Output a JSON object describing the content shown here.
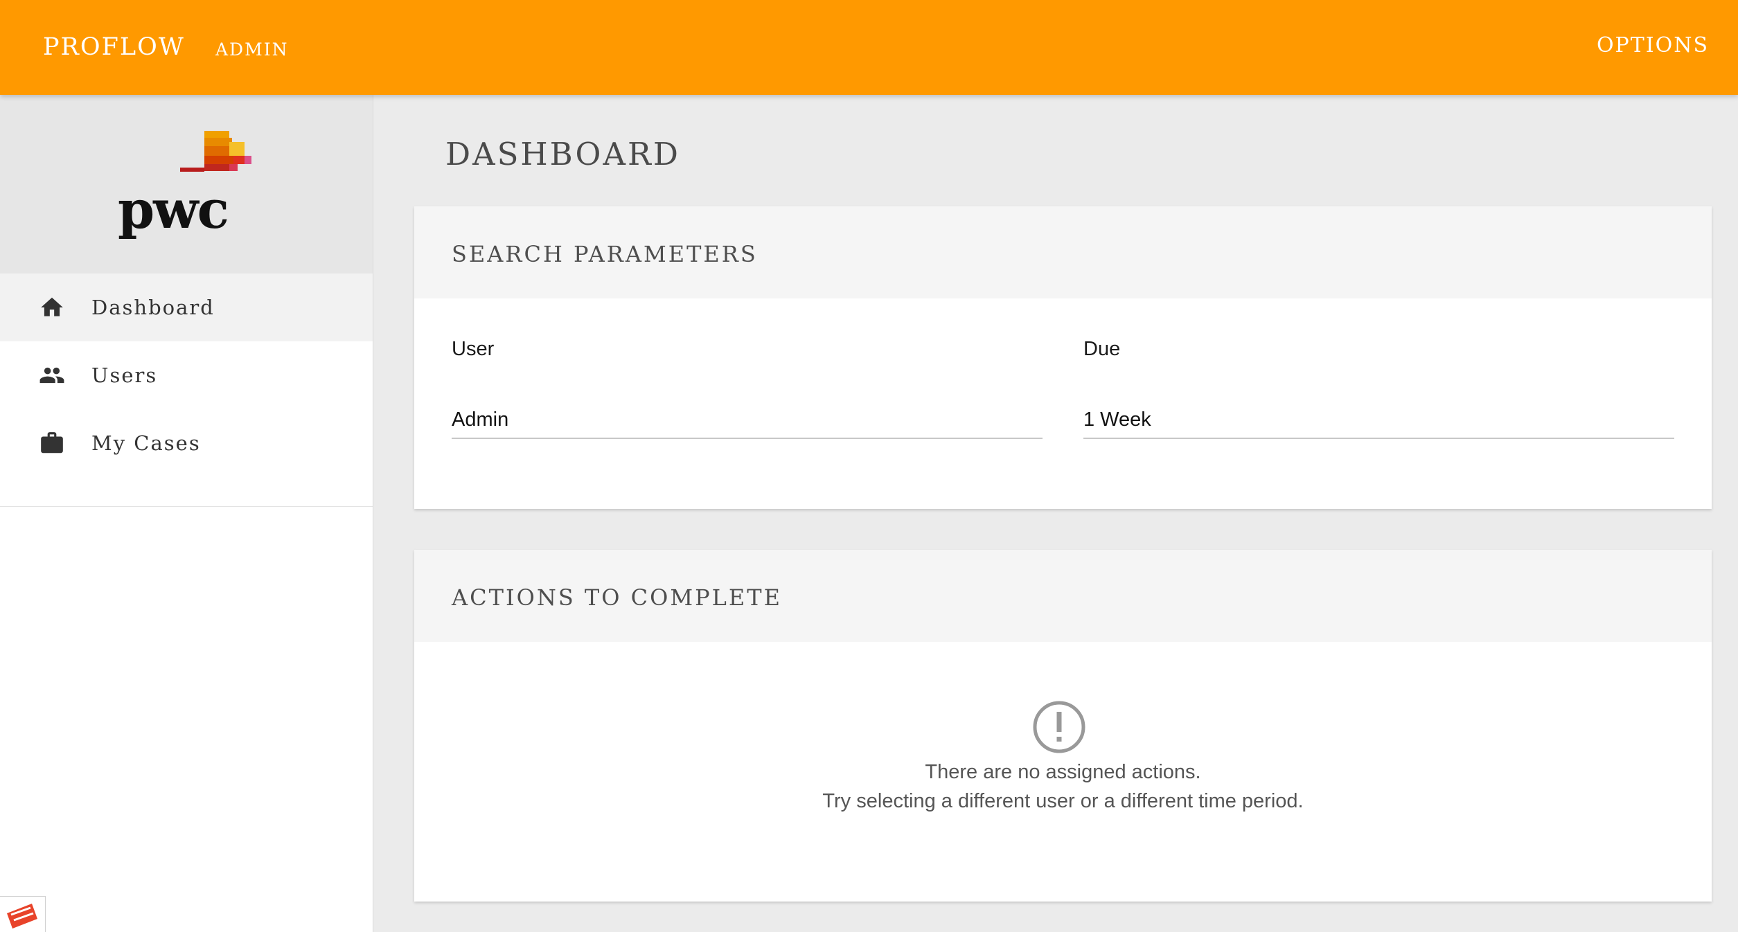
{
  "app": {
    "brand": "PROFLOW",
    "user_role": "ADMIN",
    "options_label": "OPTIONS",
    "accent_color": "#ff9900"
  },
  "logo": {
    "text": "pwc",
    "name": "pwc-logo"
  },
  "sidebar": {
    "items": [
      {
        "label": "Dashboard",
        "icon": "home-icon",
        "active": true
      },
      {
        "label": "Users",
        "icon": "people-icon",
        "active": false
      },
      {
        "label": "My Cases",
        "icon": "briefcase-icon",
        "active": false
      }
    ]
  },
  "page": {
    "title": "DASHBOARD"
  },
  "search_card": {
    "title": "SEARCH PARAMETERS",
    "user_label": "User",
    "user_value": "Admin",
    "due_label": "Due",
    "due_value": "1 Week"
  },
  "actions_card": {
    "title": "ACTIONS TO COMPLETE",
    "empty_icon": "alert-circle-icon",
    "empty_line1": "There are no assigned actions.",
    "empty_line2": "Try selecting a different user or a different time period."
  }
}
